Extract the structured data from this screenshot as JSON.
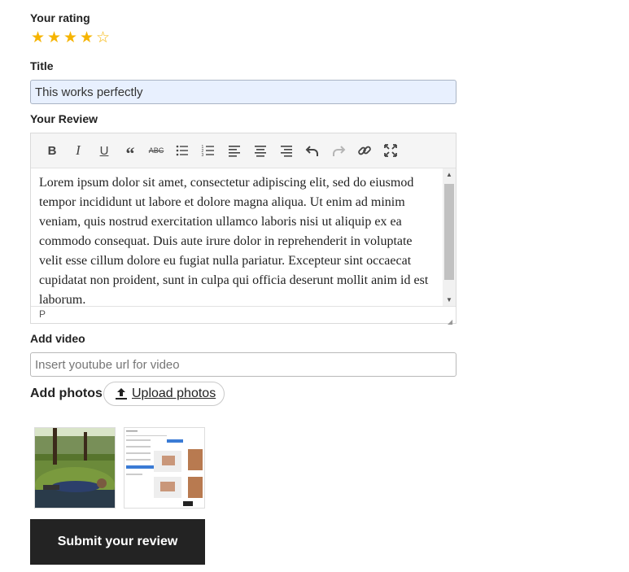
{
  "rating": {
    "label": "Your rating",
    "value": 4,
    "max": 5,
    "star_color": "#f6b400"
  },
  "title": {
    "label": "Title",
    "value": "This works perfectly"
  },
  "review": {
    "label": "Your Review",
    "toolbar": [
      "bold-icon",
      "italic-icon",
      "underline-icon",
      "blockquote-icon",
      "strikethrough-icon",
      "bullet-list-icon",
      "numbered-list-icon",
      "align-left-icon",
      "align-center-icon",
      "align-right-icon",
      "undo-icon",
      "redo-icon",
      "link-icon",
      "fullscreen-icon"
    ],
    "body": "Lorem ipsum dolor sit amet, consectetur adipiscing elit, sed do eiusmod tempor incididunt ut labore et dolore magna aliqua. Ut enim ad minim veniam, quis nostrud exercitation ullamco laboris nisi ut aliquip ex ea commodo consequat. Duis aute irure dolor in reprehenderit in voluptate velit esse cillum dolore eu fugiat nulla pariatur. Excepteur sint occaecat cupidatat non proident, sunt in culpa qui officia deserunt mollit anim id est laborum.",
    "path": "P"
  },
  "video": {
    "label": "Add video",
    "placeholder": "Insert youtube url for video"
  },
  "photos": {
    "label": "Add photos",
    "upload_label": "Upload photos"
  },
  "submit_label": "Submit your review"
}
